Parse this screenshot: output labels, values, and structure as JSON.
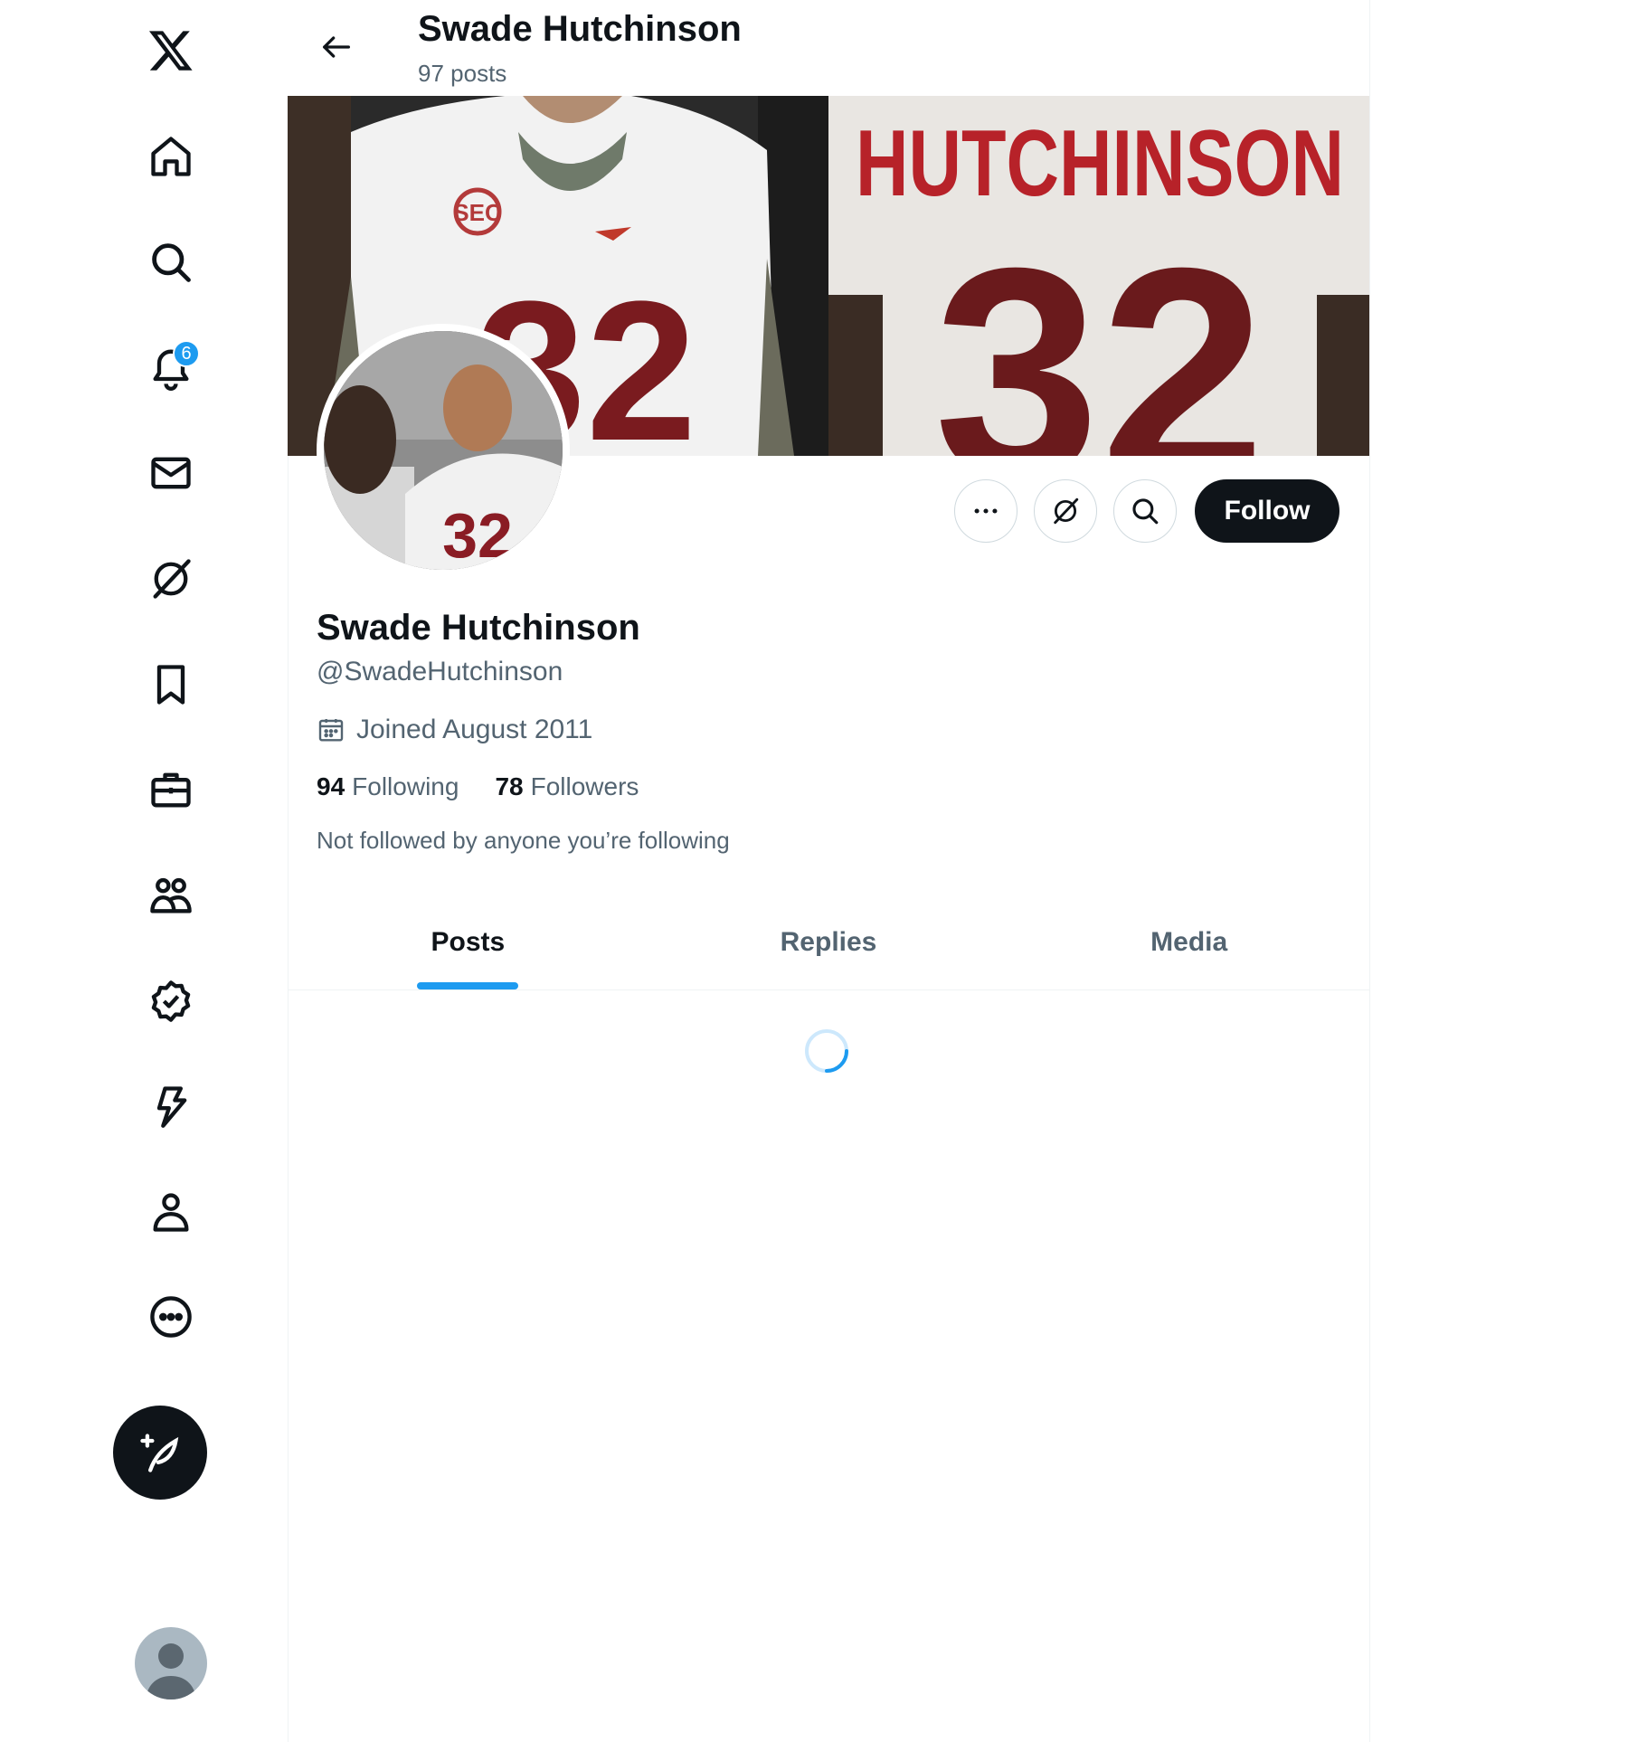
{
  "sidebar": {
    "notifications_badge": "6"
  },
  "header": {
    "title": "Swade Hutchinson",
    "posts_count": "97 posts"
  },
  "banner": {
    "jersey_name": "HUTCHINSON",
    "jersey_number": "32",
    "patch_text": "SEC"
  },
  "profile": {
    "name": "Swade Hutchinson",
    "handle": "@SwadeHutchinson",
    "joined": "Joined August 2011",
    "following_count": "94",
    "following_label": "Following",
    "followers_count": "78",
    "followers_label": "Followers",
    "not_followed_text": "Not followed by anyone you’re following",
    "follow_button": "Follow"
  },
  "tabs": [
    {
      "label": "Posts",
      "active": true
    },
    {
      "label": "Replies",
      "active": false
    },
    {
      "label": "Media",
      "active": false
    }
  ],
  "colors": {
    "accent": "#1d9bf0",
    "text": "#0f1419",
    "muted": "#536471",
    "jersey_red": "#7a1b1f"
  }
}
